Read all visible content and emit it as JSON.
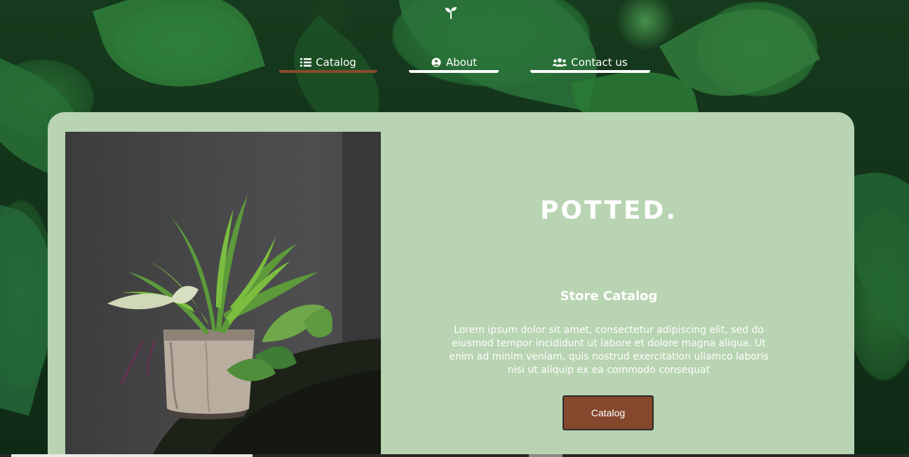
{
  "header": {
    "logo_icon": "sprout-icon",
    "nav": [
      {
        "label": "Catalog",
        "icon": "list-icon",
        "active": true
      },
      {
        "label": "About",
        "icon": "user-circle-icon",
        "active": false
      },
      {
        "label": "Contact us",
        "icon": "users-icon",
        "active": false
      }
    ]
  },
  "hero": {
    "brand": "POTTED.",
    "subtitle": "Store Catalog",
    "description": "Lorem ipsum dolor sit amet, consectetur adipiscing elit, sed do eiusmod tempor incididunt ut labore et dolore magna aliqua. Ut enim ad minim veniam, quis nostrud exercitation ullamco laboris nisi ut aliquip ex ea commodo consequat",
    "button_label": "Catalog",
    "image": "potted-plant-photo"
  },
  "colors": {
    "card_background": "#b8d4b2",
    "accent": "#86482d",
    "text": "#ffffff"
  }
}
